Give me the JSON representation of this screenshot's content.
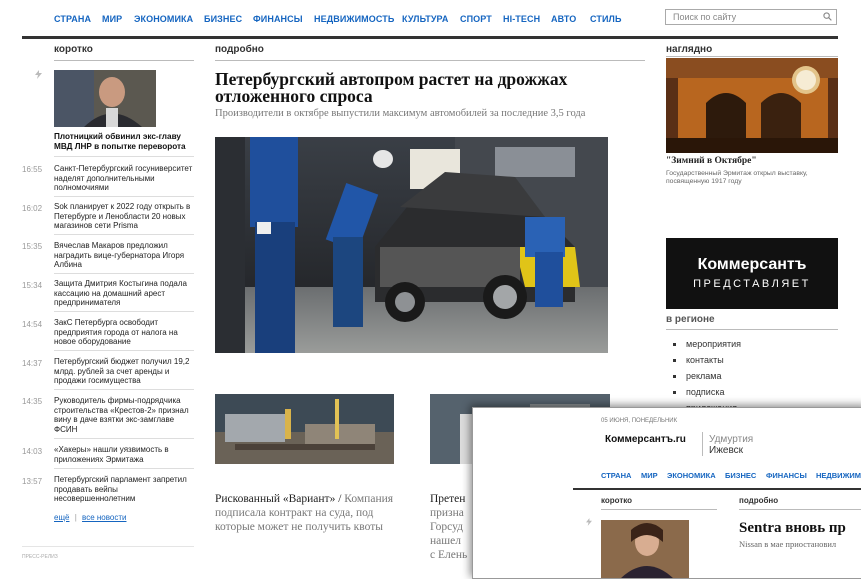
{
  "nav": {
    "items": [
      "СТРАНА",
      "МИР",
      "ЭКОНОМИКА",
      "БИЗНЕС",
      "ФИНАНСЫ",
      "НЕДВИЖИМОСТЬ",
      "КУЛЬТУРА",
      "СПОРТ",
      "HI-TECH",
      "АВТО",
      "СТИЛЬ"
    ],
    "search_placeholder": "Поиск по сайту"
  },
  "sections": {
    "short": "коротко",
    "detail": "подробно",
    "visual": "наглядно",
    "region": "в регионе"
  },
  "left": {
    "top_story": "Плотницкий обвинил экс-главу МВД ЛНР в попытке переворота",
    "news": [
      {
        "time": "16:55",
        "text": "Санкт-Петербургский госуниверситет наделят дополнительными полномочиями"
      },
      {
        "time": "16:02",
        "text": "Sok планирует к 2022 году открыть в Петербурге и Ленобласти 20 новых магазинов сети Prisma"
      },
      {
        "time": "15:35",
        "text": "Вячеслав Макаров предложил наградить вице-губернатора Игоря Албина"
      },
      {
        "time": "15:34",
        "text": "Защита Дмитрия Костыгина подала кассацию на домашний арест предпринимателя"
      },
      {
        "time": "14:54",
        "text": "ЗакС Петербурга освободит предприятия города от налога на новое оборудование"
      },
      {
        "time": "14:37",
        "text": "Петербургский бюджет получил 19,2 млрд. рублей за счет аренды и продажи госимущества"
      },
      {
        "time": "14:35",
        "text": "Руководитель фирмы-подрядчика строительства «Крестов-2» признал вину в даче взятки экс-замглаве ФСИН"
      },
      {
        "time": "14:03",
        "text": "«Хакеры» нашли уязвимость в приложениях Эрмитажа"
      },
      {
        "time": "13:57",
        "text": "Петербургский парламент запретил продавать вейпы несовершеннолетним"
      }
    ],
    "more": "ещё",
    "separator": "|",
    "all_news": "все новости",
    "press_label": "ПРЕСС-РЕЛИЗ"
  },
  "main": {
    "headline": "Петербургский автопром растет на дрожжах отложенного спроса",
    "subheadline": "Производители в октябре выпустили максимум автомобилей за последние 3,5 года",
    "story2_title": "Рискованный «Вариант»",
    "story2_sep": " / ",
    "story2_desc": "Компания подписала контракт на суда, под которые может не получить квоты",
    "story3_lines": [
      "Претен",
      "призна",
      "Горсуд",
      "нашел",
      "с Елень"
    ]
  },
  "right": {
    "visual_title": "\"Зимний в Октябре\"",
    "visual_desc": "Государственный Эрмитаж открыл выставку, посвященную 1917 году",
    "ad_line1": "Коммерсантъ",
    "ad_line2": "ПРЕДСТАВЛЯЕТ",
    "region_items": [
      "мероприятия",
      "контакты",
      "реклама",
      "подписка",
      "приложения"
    ]
  },
  "popup": {
    "date": "05 ИЮНЯ, ПОНЕДЕЛЬНИК",
    "logo": "Коммерсантъ.ru",
    "region": "Удмуртия",
    "city": "Ижевск",
    "nav": [
      "СТРАНА",
      "МИР",
      "ЭКОНОМИКА",
      "БИЗНЕС",
      "ФИНАНСЫ",
      "НЕДВИЖИМОСТЬ"
    ],
    "short": "коротко",
    "detail": "подробно",
    "headline": "Sentra вновь пр",
    "sub": "Nissan в мае приостановил"
  },
  "colors": {
    "nav_link": "#1565c0",
    "rule": "#333333",
    "ad_bg": "#111111"
  }
}
